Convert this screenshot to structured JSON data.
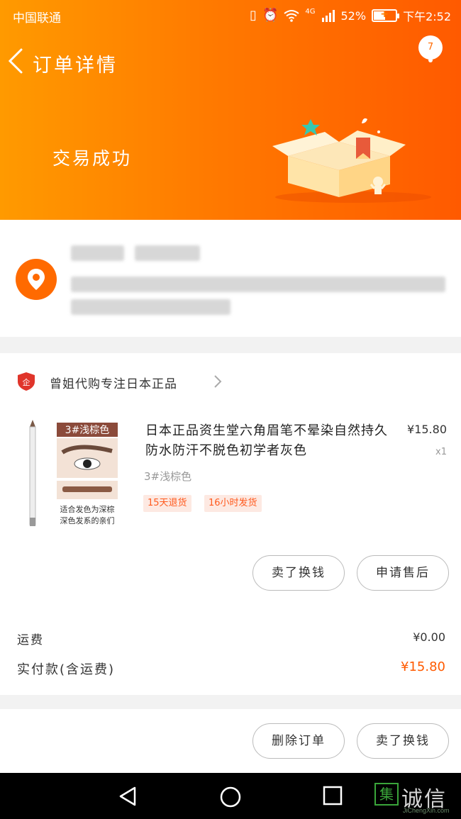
{
  "status_bar": {
    "carrier": "中国联通",
    "network": "4G",
    "battery": "52%",
    "time": "下午2:52"
  },
  "header": {
    "title": "订单详情",
    "badge_count": "7",
    "trade_status": "交易成功"
  },
  "shop": {
    "name": "曾姐代购专注日本正品",
    "badge": "企"
  },
  "product": {
    "image_label": "3#浅棕色",
    "image_caption_1": "适合发色为深棕",
    "image_caption_2": "深色发系的亲们",
    "title": "日本正品资生堂六角眉笔不晕染自然持久防水防汗不脱色初学者灰色",
    "variant": "3#浅棕色",
    "price": "¥15.80",
    "quantity": "x1",
    "tags": [
      "15天退货",
      "16小时发货"
    ]
  },
  "order_actions": {
    "sell_label": "卖了换钱",
    "after_sale_label": "申请售后"
  },
  "fees": {
    "shipping_label": "运费",
    "shipping_value": "¥0.00",
    "total_label": "实付款(含运费)",
    "total_value": "¥15.80"
  },
  "bottom_actions": {
    "delete_label": "删除订单",
    "sell_label": "卖了换钱"
  },
  "watermark": {
    "text": "诚信",
    "logo": "集",
    "url": "JiChengXin.com"
  },
  "colors": {
    "header_start": "#ff9a00",
    "header_end": "#ff5a00",
    "accent": "#ff5a00",
    "tag_bg": "#fde9e2"
  }
}
